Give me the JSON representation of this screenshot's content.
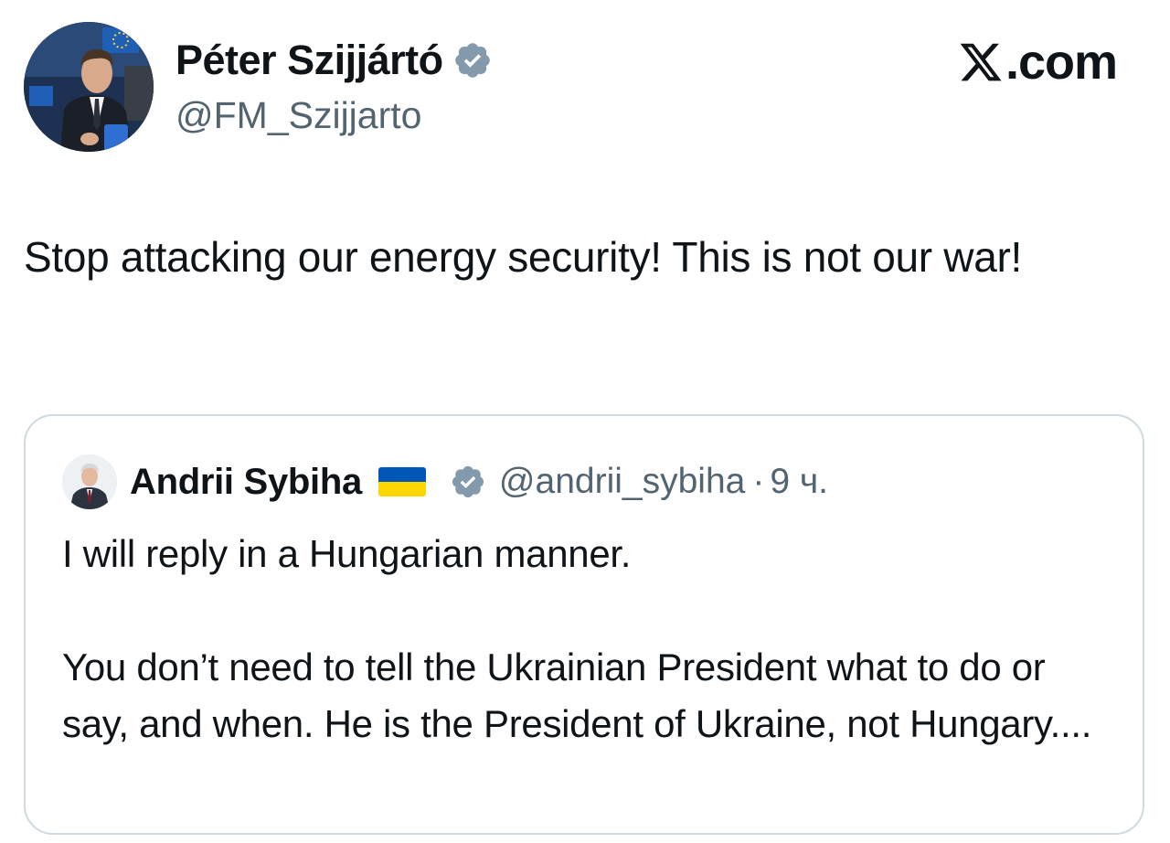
{
  "tweet": {
    "author": {
      "name": "Péter Szijjártó",
      "handle": "@FM_Szijjarto",
      "verified": true,
      "avatar_icon": "profile-photo"
    },
    "brand": {
      "label": ".com",
      "logo_icon": "x-logo-icon"
    },
    "text": "Stop attacking our energy security! This is not our war!"
  },
  "quoted_tweet": {
    "author": {
      "name": "Andrii Sybiha",
      "flag_icon": "ukraine-flag",
      "handle": "@andrii_sybiha",
      "verified": true,
      "avatar_icon": "profile-photo"
    },
    "separator": "·",
    "time": "9 ч.",
    "text": "I will reply in a Hungarian manner.\n\nYou don’t need to tell the Ukrainian President what to do or say, and when. He is the President of Ukraine, not Hungary...."
  },
  "colors": {
    "text_primary": "#0f1419",
    "text_secondary": "#536471",
    "border": "#cfd9de",
    "verified_badge": "#829aab",
    "flag_blue": "#0057b7",
    "flag_yellow": "#ffd700"
  }
}
